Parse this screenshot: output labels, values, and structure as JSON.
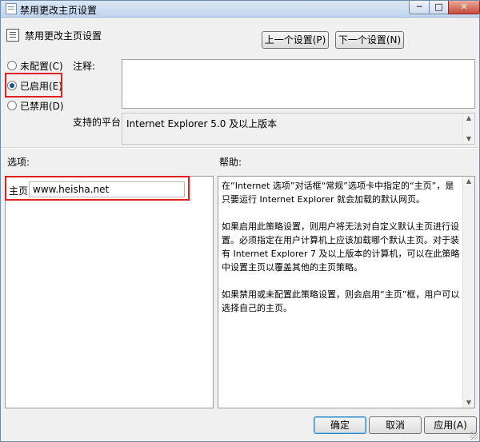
{
  "window": {
    "title": "禁用更改主页设置",
    "controls": {
      "minimize": "─",
      "maximize": "□",
      "close": "✕"
    }
  },
  "header": {
    "title": "禁用更改主页设置",
    "prev_button": "上一个设置(P)",
    "next_button": "下一个设置(N)"
  },
  "state": {
    "options": [
      {
        "label": "未配置(C)",
        "selected": false
      },
      {
        "label": "已启用(E)",
        "selected": true
      },
      {
        "label": "已禁用(D)",
        "selected": false
      }
    ]
  },
  "comment": {
    "label": "注释:",
    "value": ""
  },
  "platform": {
    "label": "支持的平台:",
    "value": "Internet Explorer 5.0 及以上版本"
  },
  "options_section": {
    "label": "选项:",
    "homepage_label": "主页",
    "homepage_value": "www.heisha.net"
  },
  "help_section": {
    "label": "帮助:",
    "paragraphs": [
      "在“Internet 选项”对话框“常规”选项卡中指定的“主页”，是只要运行 Internet Explorer 就会加载的默认网页。",
      "如果启用此策略设置，则用户将无法对自定义默认主页进行设置。必须指定在用户计算机上应该加载哪个默认主页。对于装有 Internet Explorer 7 及以上版本的计算机，可以在此策略中设置主页以覆盖其他的主页策略。",
      "如果禁用或未配置此策略设置，则会启用“主页”框，用户可以选择自己的主页。"
    ]
  },
  "footer": {
    "ok": "确定",
    "cancel": "取消",
    "apply": "应用(A)"
  },
  "colors": {
    "highlight_box": "#e02020",
    "title_bar": "#c2d5ee"
  },
  "icons": [
    "policy-setting-icon",
    "scroll-up-icon",
    "scroll-down-icon",
    "resize-grip-icon"
  ]
}
